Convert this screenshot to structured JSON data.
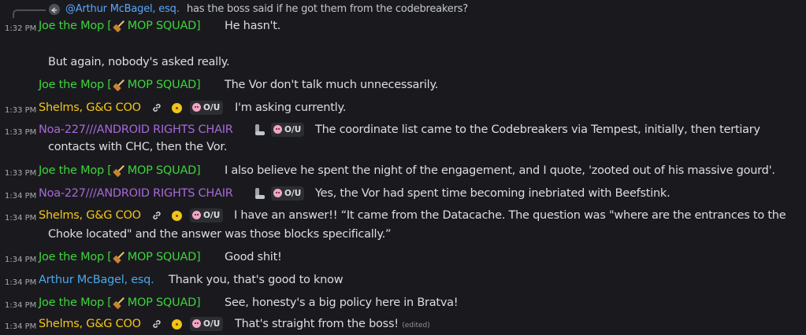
{
  "colors": {
    "background": "#1a1a1e",
    "joe": "#3dd43b",
    "shelms": "#f5c518",
    "noa": "#a768d8",
    "arthur": "#4aa8e8"
  },
  "reply": {
    "icon": "reply-arrow-icon",
    "author": "@Arthur McBagel, esq.",
    "text": "has the boss said if he got them from the codebreakers?"
  },
  "messages": [
    {
      "time": "1:32 PM",
      "author": "Joe the Mop [",
      "author_tail": "MOP SQUAD]",
      "lines": [
        "He hasn't."
      ]
    },
    {
      "time": "",
      "author": "",
      "lines": [
        "But again, nobody's asked really."
      ]
    },
    {
      "time": "",
      "author": "Joe the Mop [",
      "author_tail": "MOP SQUAD]",
      "lines": [
        "The Vor don't talk much unnecessarily."
      ]
    },
    {
      "time": "1:33 PM",
      "author": "Shelms, G&G COO",
      "badge": "O/U",
      "lines": [
        "I'm asking currently."
      ]
    },
    {
      "time": "1:33 PM",
      "author": "Noa-227///ANDROID RIGHTS CHAIR",
      "badge": "O/U",
      "lines": [
        "The coordinate list came to the Codebreakers via Tempest, initially, then tertiary",
        "contacts with CHC, then the Vor."
      ]
    },
    {
      "time": "1:33 PM",
      "author": "Joe the Mop [",
      "author_tail": "MOP SQUAD]",
      "lines": [
        "I also believe he spent the night of the engagement, and I quote, 'zooted out of his massive gourd'."
      ]
    },
    {
      "time": "1:34 PM",
      "author": "Noa-227///ANDROID RIGHTS CHAIR",
      "badge": "O/U",
      "lines": [
        "Yes, the Vor had spent time becoming inebriated with Beefstink."
      ]
    },
    {
      "time": "1:34 PM",
      "author": "Shelms, G&G COO",
      "badge": "O/U",
      "lines": [
        "I have an answer!! “It came from the Datacache. The question was \"where are the entrances to the",
        "Choke located\" and the answer was those blocks specifically.”"
      ]
    },
    {
      "time": "1:34 PM",
      "author": "Joe the Mop [",
      "author_tail": "MOP SQUAD]",
      "lines": [
        "Good shit!"
      ]
    },
    {
      "time": "1:34 PM",
      "author": "Arthur McBagel, esq.",
      "lines": [
        "Thank you, that's good to know"
      ]
    },
    {
      "time": "1:34 PM",
      "author": "Joe the Mop [",
      "author_tail": "MOP SQUAD]",
      "lines": [
        "See, honesty's a big policy here in Bratva!"
      ]
    },
    {
      "time": "1:34 PM",
      "author": "Shelms, G&G COO",
      "badge": "O/U",
      "lines": [
        "That's straight from the boss!"
      ],
      "edited": "(edited)"
    }
  ]
}
